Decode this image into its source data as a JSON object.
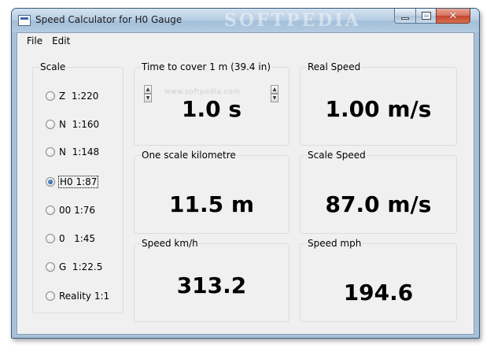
{
  "window": {
    "title": "Speed Calculator for H0 Gauge",
    "watermark": "SOFTPEDIA",
    "close_glyph": "✕"
  },
  "menu": [
    "File",
    "Edit"
  ],
  "scale": {
    "label": "Scale",
    "options": [
      {
        "label": "Z  1:220",
        "checked": false
      },
      {
        "label": "N  1:160",
        "checked": false
      },
      {
        "label": "N  1:148",
        "checked": false
      },
      {
        "label": "H0 1:87",
        "checked": true
      },
      {
        "label": "00 1:76",
        "checked": false
      },
      {
        "label": "0   1:45",
        "checked": false
      },
      {
        "label": "G  1:22.5",
        "checked": false
      },
      {
        "label": "Reality 1:1",
        "checked": false
      }
    ]
  },
  "panels": {
    "time": {
      "label": "Time to cover 1 m (39.4 in)",
      "value": "1.0 s",
      "watermark": "www.softpedia.com",
      "spin_up": "▲",
      "spin_down": "▼"
    },
    "real_speed": {
      "label": "Real Speed",
      "value": "1.00 m/s"
    },
    "scale_km": {
      "label": "One scale kilometre",
      "value": "11.5 m"
    },
    "scale_speed": {
      "label": "Scale Speed",
      "value": "87.0 m/s"
    },
    "kmh": {
      "label": "Speed km/h",
      "value": "313.2"
    },
    "mph": {
      "label": "Speed mph",
      "value": "194.6"
    }
  }
}
